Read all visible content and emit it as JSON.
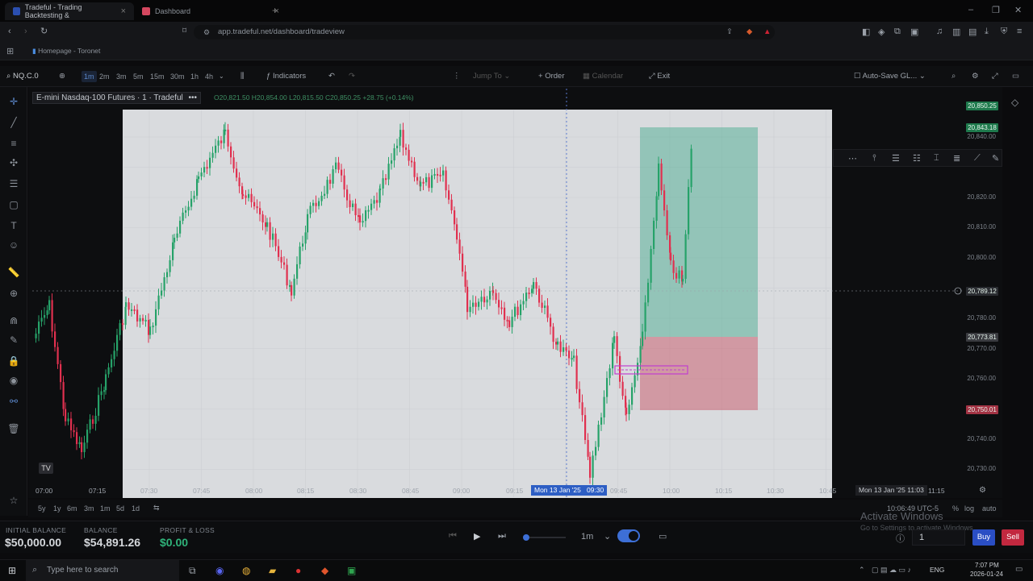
{
  "browser": {
    "tabs": [
      {
        "label": "Tradeful - Trading Backtesting &",
        "active": true,
        "favicon_color": "#2b4fb0"
      },
      {
        "label": "Dashboard",
        "active": false,
        "favicon_color": "#d4475f"
      }
    ],
    "url": "app.tradeful.net/dashboard/tradeview",
    "bookmark": "Homepage - Toronet"
  },
  "toolbar": {
    "symbol": "NQ.C.0",
    "timeframes": [
      "1m",
      "2m",
      "3m",
      "5m",
      "15m",
      "30m",
      "1h",
      "4h"
    ],
    "active_timeframe": "1m",
    "indicators_label": "Indicators",
    "jump_to_label": "Jump To",
    "order_label": "Order",
    "calendar_label": "Calendar",
    "exit_label": "Exit",
    "autosave_label": "Auto-Save GL..."
  },
  "chart": {
    "legend_title": "E-mini Nasdaq-100 Futures · 1 · Tradeful",
    "ohlc": "O20,821.50 H20,854.00 L20,815.50 C20,850.25 +28.75 (+0.14%)",
    "price_labels": [
      "20,840.00",
      "20,820.00",
      "20,810.00",
      "20,800.00",
      "20,780.00",
      "20,770.00",
      "20,760.00",
      "20,740.00",
      "20,730.00"
    ],
    "price_badges": [
      {
        "value": "20,850.25",
        "color": "#1f7a4d"
      },
      {
        "value": "20,843.18",
        "color": "#1f7a4d"
      },
      {
        "value": "20,789.12",
        "color": "#2a2c31"
      },
      {
        "value": "20,773.81",
        "color": "#3a3b40"
      },
      {
        "value": "20,750.01",
        "color": "#a33344"
      }
    ],
    "time_labels": [
      "07:00",
      "07:15",
      "07:30",
      "07:45",
      "08:00",
      "08:15",
      "08:30",
      "08:45",
      "09:00",
      "09:15",
      "09:45",
      "10:00",
      "10:15",
      "10:30",
      "10:45",
      "11:15"
    ],
    "crosshair_time": "Mon 13 Jan '25",
    "crosshair_clock": "09:30",
    "right_time_badge": "Mon 13 Jan '25   11:03",
    "colors": {
      "up": "#26a269",
      "down": "#e0304f",
      "target": "#3fa88a",
      "stop": "#c84a5a"
    }
  },
  "range_bar": {
    "ranges": [
      "5y",
      "1y",
      "6m",
      "3m",
      "1m",
      "5d",
      "1d"
    ],
    "clock": "10:06:49 UTC-5",
    "pct": "%",
    "log": "log",
    "auto": "auto"
  },
  "account": {
    "initial_balance_label": "INITIAL BALANCE",
    "initial_balance": "$50,000.00",
    "balance_label": "BALANCE",
    "balance": "$54,891.26",
    "pnl_label": "PROFIT & LOSS",
    "pnl": "$0.00",
    "speed": "1m",
    "quantity": "1",
    "buy_label": "Buy",
    "sell_label": "Sell",
    "activate_title": "Activate Windows",
    "activate_sub": "Go to Settings to activate Windows."
  },
  "taskbar": {
    "search_placeholder": "Type here to search",
    "lang": "ENG",
    "time": "7:07 PM",
    "date": "2026-01-24"
  }
}
